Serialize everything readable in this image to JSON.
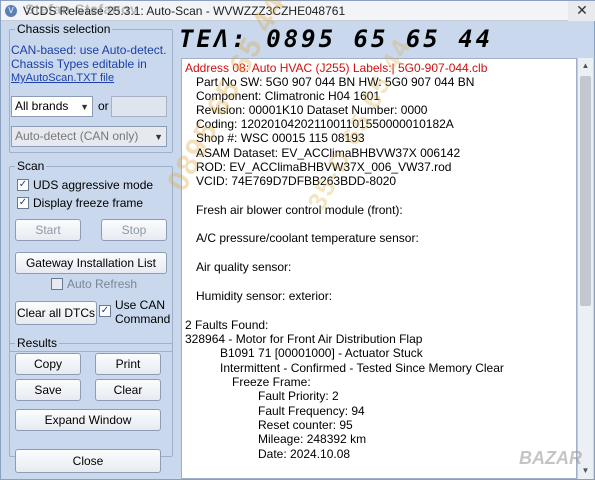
{
  "window": {
    "title": "VCDS Release 25.3.1:  Auto-Scan - WVWZZZ3CZHE048761",
    "watermark_name": "Stefan Stefanov",
    "close_glyph": "✕"
  },
  "left": {
    "chassis_group_label": "Chassis selection",
    "info_text": "CAN-based: use Auto-detect. Chassis Types editable in",
    "info_link": "MyAutoScan.TXT file",
    "brand_select": "All brands",
    "or_label": "or",
    "detect_select": "Auto-detect (CAN only)",
    "scan_group_label": "Scan",
    "uds_label": "UDS aggressive mode",
    "freeze_label": "Display freeze frame",
    "start_label": "Start",
    "stop_label": "Stop",
    "gateway_label": "Gateway Installation List",
    "auto_refresh_label": "Auto Refresh",
    "clear_dtcs_label": "Clear all DTCs",
    "use_can_label": "Use CAN Command",
    "results_group_label": "Results",
    "copy_label": "Copy",
    "print_label": "Print",
    "save_label": "Save",
    "clear_label": "Clear",
    "expand_label": "Expand Window",
    "close_label": "Close",
    "check_glyph": "✓",
    "arrow_glyph": "▼"
  },
  "overlay": {
    "phone_banner": "TEΛ:  0895  65  65  44",
    "diag_text_1": "0895 65 65 44",
    "diag_text_2": "35-D 65 65 44",
    "bazar_mark": "BAZAR"
  },
  "report": {
    "address_line": "Address 08: Auto HVAC (J255)        Labels:| 5G0-907-044.clb",
    "lines": [
      "Part No SW: 5G0 907 044 BN    HW: 5G0 907 044 BN",
      "Component: Climatronic    H04 1601",
      "Revision: 00001K10     Dataset Number: 0000",
      "Coding: 1202010420211001101550000010182A",
      "Shop #: WSC 00015 115 08193",
      "ASAM Dataset: EV_ACClimaBHBVW37X 006142",
      "ROD: EV_ACClimaBHBVW37X_006_VW37.rod",
      "VCID: 74E769D7DFBB263BDD-8020"
    ],
    "sensors": [
      "Fresh air blower control module (front):",
      "A/C pressure/coolant temperature sensor:",
      "Air quality sensor:",
      "Humidity sensor: exterior:"
    ],
    "faults_header": "2 Faults Found:",
    "fault_code": "328964 - Motor for Front Air Distribution Flap",
    "fault_detail": "B1091 71 [00001000] - Actuator Stuck",
    "fault_status": "Intermittent - Confirmed - Tested Since Memory Clear",
    "freeze_frame": "Freeze Frame:",
    "freeze_rows": [
      "Fault Priority: 2",
      "Fault Frequency: 94",
      "Reset counter: 95",
      "Mileage: 248392 km",
      "Date: 2024.10.08"
    ]
  }
}
